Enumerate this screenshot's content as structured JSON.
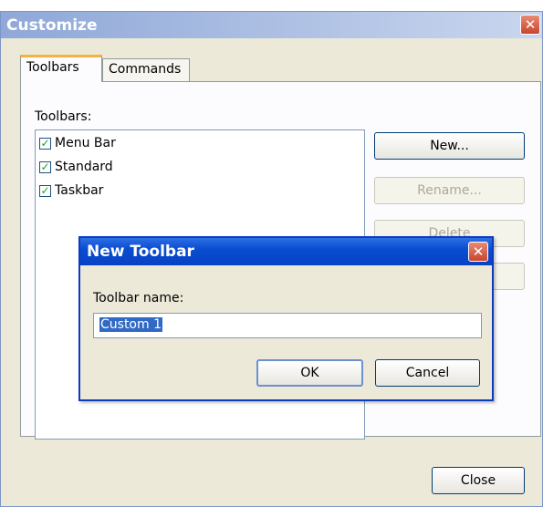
{
  "window": {
    "title": "Customize",
    "close_glyph": "✕"
  },
  "tabs": [
    {
      "label": "Toolbars",
      "active": true
    },
    {
      "label": "Commands",
      "active": false
    }
  ],
  "toolbars_label": "Toolbars:",
  "toolbar_list": [
    {
      "label": "Menu Bar",
      "checked": true
    },
    {
      "label": "Standard",
      "checked": true
    },
    {
      "label": "Taskbar",
      "checked": true
    }
  ],
  "check_glyph": "✓",
  "buttons": {
    "new": "New...",
    "rename": "Rename...",
    "delete": "Delete",
    "close": "Close"
  },
  "dialog": {
    "title": "New Toolbar",
    "close_glyph": "✕",
    "field_label": "Toolbar name:",
    "field_value": "Custom 1",
    "ok": "OK",
    "cancel": "Cancel"
  },
  "colors": {
    "title_active": "#0a4dd1",
    "close_red": "#c8452c",
    "selection": "#316ac5"
  }
}
